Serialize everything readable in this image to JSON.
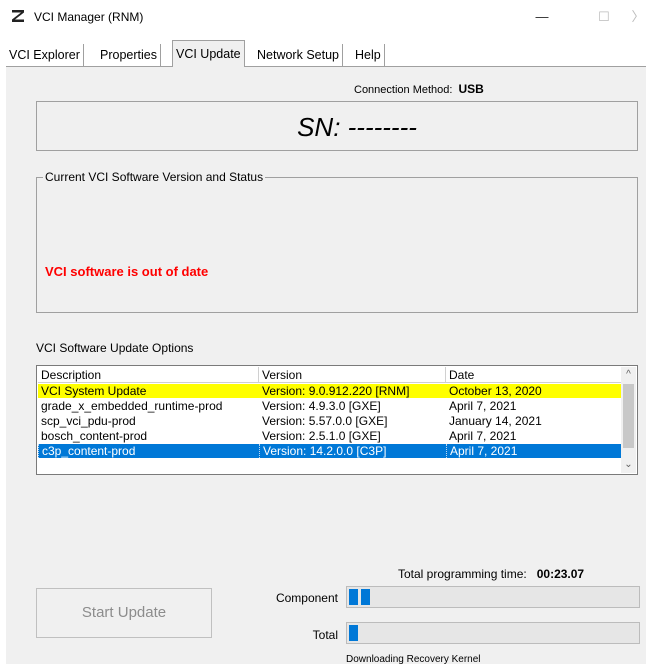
{
  "window": {
    "title": "VCI Manager (RNM)",
    "minimize": "—",
    "maximize": "☐",
    "close": "〉"
  },
  "tabs": [
    {
      "label": "VCI Explorer"
    },
    {
      "label": "Properties"
    },
    {
      "label": "VCI Update"
    },
    {
      "label": "Network Setup"
    },
    {
      "label": "Help"
    }
  ],
  "active_tab": "VCI Update",
  "connection": {
    "label": "Connection Method:",
    "value": "USB"
  },
  "serial": "SN: --------",
  "current_group": {
    "legend": "Current VCI Software Version and Status",
    "status": "VCI software is out of date"
  },
  "options": {
    "label": "VCI Software Update Options",
    "columns": [
      "Description",
      "Version",
      "Date"
    ],
    "rows": [
      {
        "description": "VCI System Update",
        "version": "Version: 9.0.912.220 [RNM]",
        "date": "October 13, 2020",
        "highlight": "#ffff00"
      },
      {
        "description": "grade_x_embedded_runtime-prod",
        "version": "Version: 4.9.3.0 [GXE]",
        "date": "April 7, 2021"
      },
      {
        "description": "scp_vci_pdu-prod",
        "version": "Version: 5.57.0.0 [GXE]",
        "date": "January 14, 2021"
      },
      {
        "description": "bosch_content-prod",
        "version": "Version: 2.5.1.0 [GXE]",
        "date": "April 7, 2021"
      },
      {
        "description": "c3p_content-prod",
        "version": "Version: 14.2.0.0 [C3P]",
        "date": "April 7, 2021",
        "selected": true
      }
    ]
  },
  "programming": {
    "total_time_label": "Total programming time:",
    "total_time_value": "00:23.07",
    "component_label": "Component",
    "total_label": "Total",
    "component_blocks": 2,
    "total_blocks": 1,
    "caption": "Downloading Recovery Kernel"
  },
  "start_button": "Start Update",
  "colors": {
    "selection": "#0078d7",
    "warning": "#ff0000",
    "highlight": "#ffff00"
  }
}
